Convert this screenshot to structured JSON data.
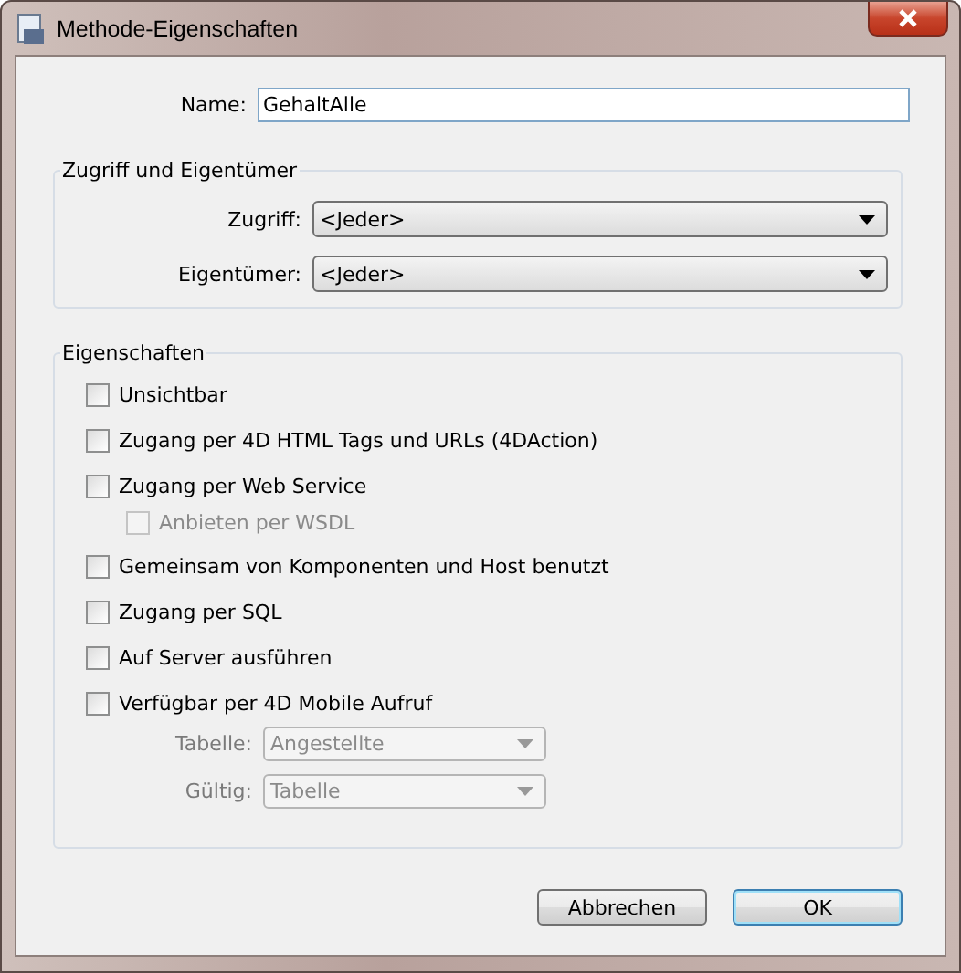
{
  "window": {
    "title": "Methode-Eigenschaften"
  },
  "name_field": {
    "label": "Name:",
    "value": "GehaltAlle"
  },
  "access_group": {
    "title": "Zugriff und Eigentümer",
    "selects": [
      {
        "label": "Zugriff:",
        "value": "<Jeder>",
        "disabled": false
      },
      {
        "label": "Eigentümer:",
        "value": "<Jeder>",
        "disabled": false
      }
    ]
  },
  "properties_group": {
    "title": "Eigenschaften",
    "items": [
      {
        "label": "Unsichtbar",
        "checked": false,
        "disabled": false
      },
      {
        "label": "Zugang per 4D HTML Tags und URLs (4DAction)",
        "checked": false,
        "disabled": false
      },
      {
        "label": "Zugang per Web Service",
        "checked": false,
        "disabled": false,
        "children": [
          {
            "label": "Anbieten per WSDL",
            "checked": false,
            "disabled": true
          }
        ]
      },
      {
        "label": "Gemeinsam von Komponenten und Host benutzt",
        "checked": false,
        "disabled": false
      },
      {
        "label": "Zugang per SQL",
        "checked": false,
        "disabled": false
      },
      {
        "label": "Auf Server ausführen",
        "checked": false,
        "disabled": false
      },
      {
        "label": "Verfügbar per 4D Mobile Aufruf",
        "checked": false,
        "disabled": false,
        "selects": [
          {
            "label": "Tabelle:",
            "value": "Angestellte",
            "disabled": true
          },
          {
            "label": "Gültig:",
            "value": "Tabelle",
            "disabled": true
          }
        ]
      }
    ]
  },
  "buttons": [
    {
      "label": "Abbrechen",
      "default": false
    },
    {
      "label": "OK",
      "default": true
    }
  ]
}
